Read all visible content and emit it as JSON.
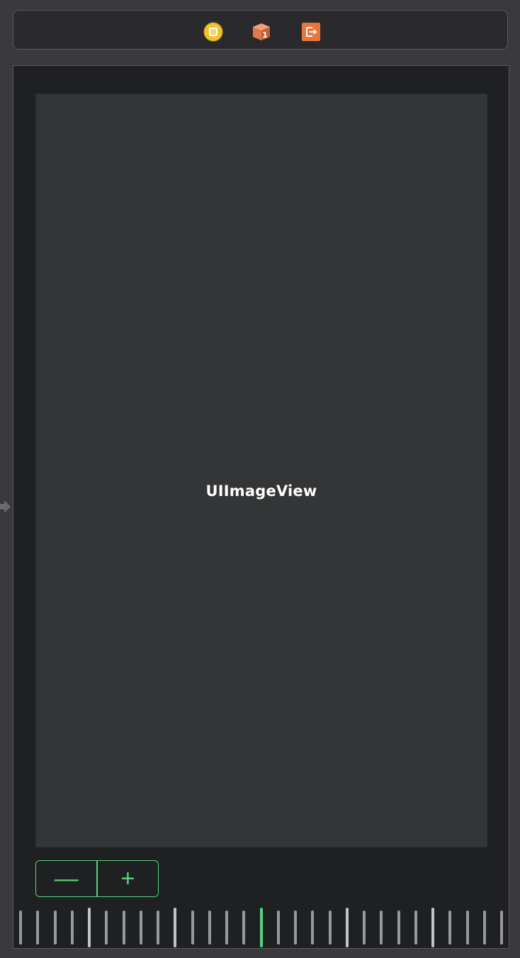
{
  "scene_dock": {
    "icons": [
      "view-controller-icon",
      "first-responder-icon",
      "exit-icon"
    ],
    "colors": {
      "view_controller": "#f2c12e",
      "first_responder": "#e07a4a",
      "exit": "#e8773e"
    }
  },
  "canvas": {
    "image_view": {
      "label": "UIImageView"
    }
  },
  "stepper": {
    "minus_label": "—",
    "plus_label": "+",
    "accent_color": "#56d37a"
  },
  "slider": {
    "tick_count": 29,
    "selected_tick_index": 14,
    "accent_color": "#56d37a"
  }
}
